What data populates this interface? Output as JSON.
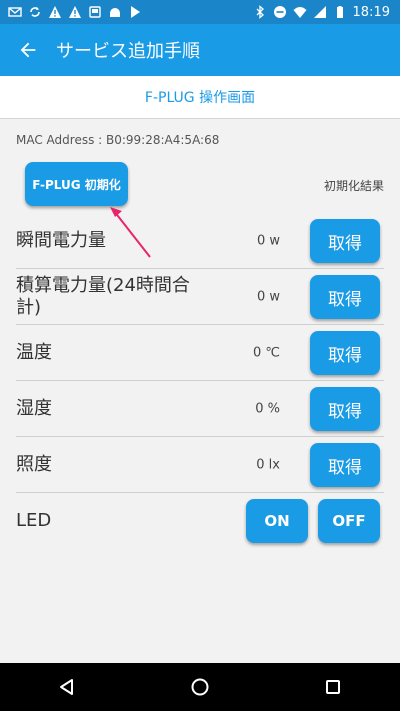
{
  "status_bar": {
    "time": "18:19",
    "colors": {
      "bg": "#1a86c9"
    }
  },
  "app_bar": {
    "title": "サービス追加手順",
    "back_icon": "arrow-left-icon",
    "color": "#1a9be6"
  },
  "sub_header": {
    "title": "F-PLUG 操作画面"
  },
  "device": {
    "mac_address": "MAC Address : B0:99:28:A4:5A:68",
    "init_button": "F-PLUG 初期化",
    "init_result": "初期化結果"
  },
  "rows": [
    {
      "label": "瞬間電力量",
      "value": "0 w",
      "button": "取得"
    },
    {
      "label": "積算電力量(24時間合計)",
      "value": "0 w",
      "button": "取得"
    },
    {
      "label": "温度",
      "value": "0 ℃",
      "button": "取得"
    },
    {
      "label": "湿度",
      "value": "0 %",
      "button": "取得"
    },
    {
      "label": "照度",
      "value": "0 lx",
      "button": "取得"
    }
  ],
  "led": {
    "label": "LED",
    "on": "ON",
    "off": "OFF"
  },
  "annotation": {
    "arrow_color": "#e8256b"
  },
  "nav": {
    "back": "back-triangle-icon",
    "home": "home-circle-icon",
    "recents": "recents-square-icon"
  }
}
